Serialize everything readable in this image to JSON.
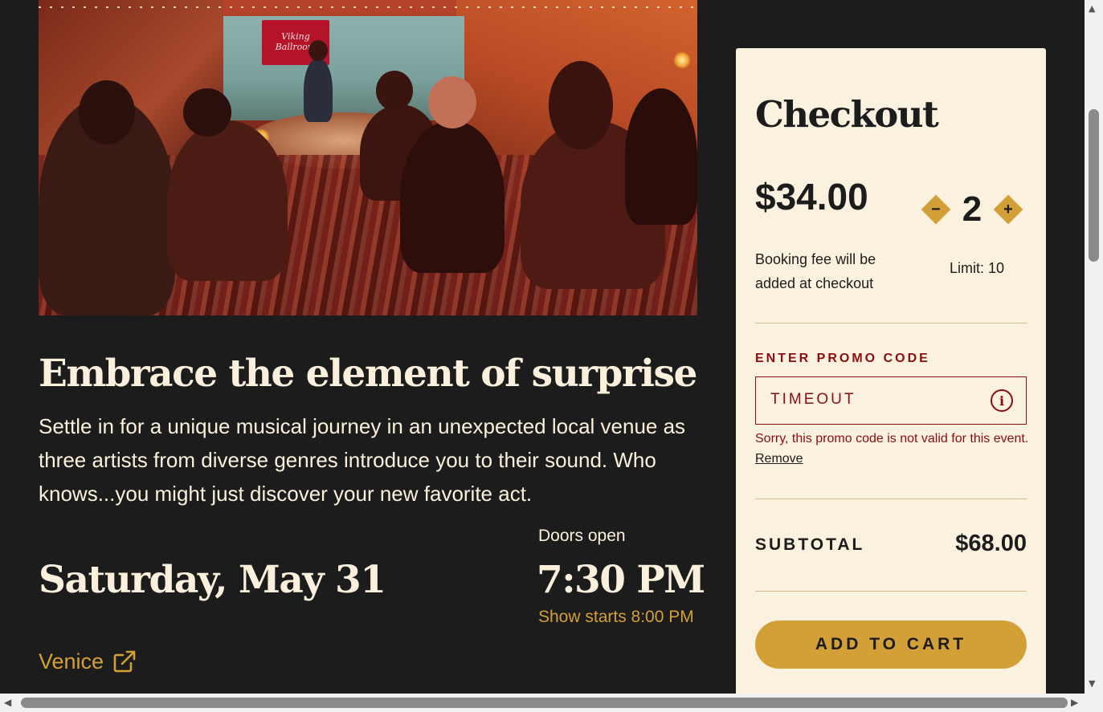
{
  "event": {
    "title": "Embrace the element of surprise",
    "description": "Settle in for a unique musical journey in an unexpected local venue as three artists from diverse genres introduce you to their sound. Who knows...you might just discover your new favorite act.",
    "date": "Saturday, May 31",
    "doors_label": "Doors open",
    "doors_time": "7:30 PM",
    "show_starts": "Show starts 8:00 PM",
    "venue": "Venice"
  },
  "checkout": {
    "title": "Checkout",
    "price": "$34.00",
    "quantity": "2",
    "decrease_symbol": "−",
    "increase_symbol": "+",
    "fee_note": "Booking fee will be added at checkout",
    "limit": "Limit: 10",
    "promo_label": "ENTER PROMO CODE",
    "promo_value": "TIMEOUT",
    "info_symbol": "i",
    "promo_error": "Sorry, this promo code is not valid for this event.",
    "promo_remove": "Remove",
    "subtotal_label": "SUBTOTAL",
    "subtotal_value": "$68.00",
    "add_to_cart": "ADD TO CART"
  },
  "scrollbars": {
    "up_arrow": "▲",
    "down_arrow": "▼",
    "left_arrow": "◀",
    "right_arrow": "▶"
  },
  "hero": {
    "banner_text": "Viking Ballroom"
  },
  "colors": {
    "background": "#1c1c1c",
    "cream": "#fbf1df",
    "gold": "#d39f37",
    "error_red": "#8b0d10"
  },
  "icons": {
    "venue_link": "external-link-icon",
    "promo_info": "info-icon",
    "qty_minus": "minus-diamond-icon",
    "qty_plus": "plus-diamond-icon"
  }
}
